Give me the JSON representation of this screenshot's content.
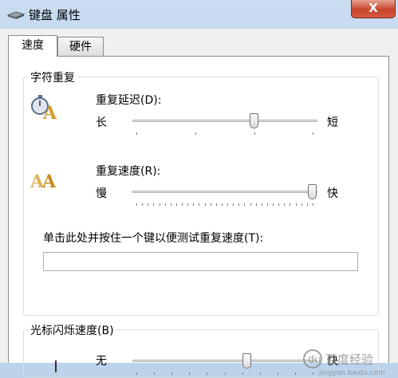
{
  "window": {
    "title": "键盘 属性",
    "close_label": "X"
  },
  "tabs": [
    {
      "label": "速度",
      "active": true
    },
    {
      "label": "硬件",
      "active": false
    }
  ],
  "char_repeat": {
    "group_title": "字符重复",
    "delay": {
      "label": "重复延迟(D):",
      "min_label": "长",
      "max_label": "短",
      "value_fraction": 0.66
    },
    "rate": {
      "label": "重复速度(R):",
      "min_label": "慢",
      "max_label": "快",
      "value_fraction": 1.0
    },
    "test_label": "单击此处并按住一个键以便测试重复速度(T):",
    "test_value": ""
  },
  "cursor_blink": {
    "group_title": "光标闪烁速度(B)",
    "min_label": "无",
    "max_label": "快",
    "value_fraction": 0.6
  },
  "icons": {
    "title": "keyboard-icon",
    "delay": "stopwatch-A-icon",
    "rate": "double-A-icon",
    "cursor": "text-cursor-icon"
  },
  "watermark": {
    "text": "百度经验",
    "sub": "jingyan.baidu.com"
  }
}
